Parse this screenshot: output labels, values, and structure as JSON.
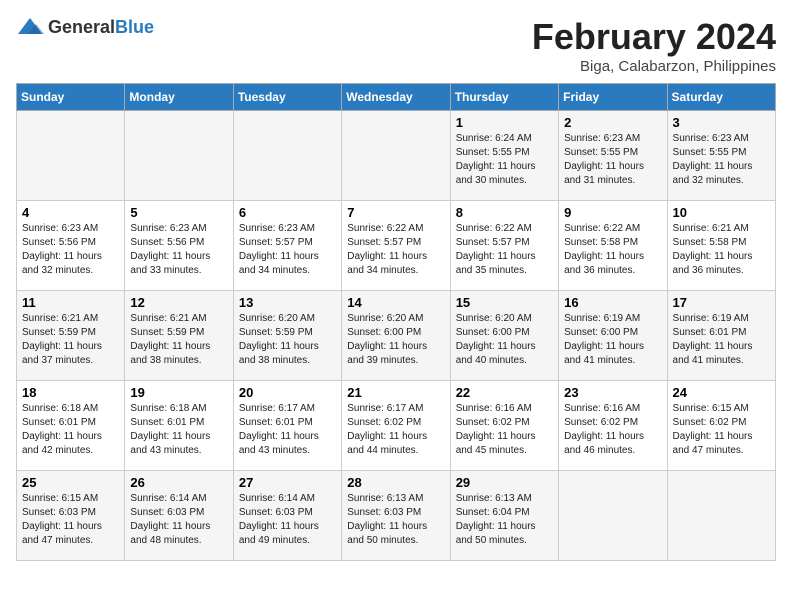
{
  "logo": {
    "general": "General",
    "blue": "Blue"
  },
  "title": "February 2024",
  "subtitle": "Biga, Calabarzon, Philippines",
  "days_header": [
    "Sunday",
    "Monday",
    "Tuesday",
    "Wednesday",
    "Thursday",
    "Friday",
    "Saturday"
  ],
  "weeks": [
    [
      {
        "day": "",
        "info": ""
      },
      {
        "day": "",
        "info": ""
      },
      {
        "day": "",
        "info": ""
      },
      {
        "day": "",
        "info": ""
      },
      {
        "day": "1",
        "info": "Sunrise: 6:24 AM\nSunset: 5:55 PM\nDaylight: 11 hours and 30 minutes."
      },
      {
        "day": "2",
        "info": "Sunrise: 6:23 AM\nSunset: 5:55 PM\nDaylight: 11 hours and 31 minutes."
      },
      {
        "day": "3",
        "info": "Sunrise: 6:23 AM\nSunset: 5:55 PM\nDaylight: 11 hours and 32 minutes."
      }
    ],
    [
      {
        "day": "4",
        "info": "Sunrise: 6:23 AM\nSunset: 5:56 PM\nDaylight: 11 hours and 32 minutes."
      },
      {
        "day": "5",
        "info": "Sunrise: 6:23 AM\nSunset: 5:56 PM\nDaylight: 11 hours and 33 minutes."
      },
      {
        "day": "6",
        "info": "Sunrise: 6:23 AM\nSunset: 5:57 PM\nDaylight: 11 hours and 34 minutes."
      },
      {
        "day": "7",
        "info": "Sunrise: 6:22 AM\nSunset: 5:57 PM\nDaylight: 11 hours and 34 minutes."
      },
      {
        "day": "8",
        "info": "Sunrise: 6:22 AM\nSunset: 5:57 PM\nDaylight: 11 hours and 35 minutes."
      },
      {
        "day": "9",
        "info": "Sunrise: 6:22 AM\nSunset: 5:58 PM\nDaylight: 11 hours and 36 minutes."
      },
      {
        "day": "10",
        "info": "Sunrise: 6:21 AM\nSunset: 5:58 PM\nDaylight: 11 hours and 36 minutes."
      }
    ],
    [
      {
        "day": "11",
        "info": "Sunrise: 6:21 AM\nSunset: 5:59 PM\nDaylight: 11 hours and 37 minutes."
      },
      {
        "day": "12",
        "info": "Sunrise: 6:21 AM\nSunset: 5:59 PM\nDaylight: 11 hours and 38 minutes."
      },
      {
        "day": "13",
        "info": "Sunrise: 6:20 AM\nSunset: 5:59 PM\nDaylight: 11 hours and 38 minutes."
      },
      {
        "day": "14",
        "info": "Sunrise: 6:20 AM\nSunset: 6:00 PM\nDaylight: 11 hours and 39 minutes."
      },
      {
        "day": "15",
        "info": "Sunrise: 6:20 AM\nSunset: 6:00 PM\nDaylight: 11 hours and 40 minutes."
      },
      {
        "day": "16",
        "info": "Sunrise: 6:19 AM\nSunset: 6:00 PM\nDaylight: 11 hours and 41 minutes."
      },
      {
        "day": "17",
        "info": "Sunrise: 6:19 AM\nSunset: 6:01 PM\nDaylight: 11 hours and 41 minutes."
      }
    ],
    [
      {
        "day": "18",
        "info": "Sunrise: 6:18 AM\nSunset: 6:01 PM\nDaylight: 11 hours and 42 minutes."
      },
      {
        "day": "19",
        "info": "Sunrise: 6:18 AM\nSunset: 6:01 PM\nDaylight: 11 hours and 43 minutes."
      },
      {
        "day": "20",
        "info": "Sunrise: 6:17 AM\nSunset: 6:01 PM\nDaylight: 11 hours and 43 minutes."
      },
      {
        "day": "21",
        "info": "Sunrise: 6:17 AM\nSunset: 6:02 PM\nDaylight: 11 hours and 44 minutes."
      },
      {
        "day": "22",
        "info": "Sunrise: 6:16 AM\nSunset: 6:02 PM\nDaylight: 11 hours and 45 minutes."
      },
      {
        "day": "23",
        "info": "Sunrise: 6:16 AM\nSunset: 6:02 PM\nDaylight: 11 hours and 46 minutes."
      },
      {
        "day": "24",
        "info": "Sunrise: 6:15 AM\nSunset: 6:02 PM\nDaylight: 11 hours and 47 minutes."
      }
    ],
    [
      {
        "day": "25",
        "info": "Sunrise: 6:15 AM\nSunset: 6:03 PM\nDaylight: 11 hours and 47 minutes."
      },
      {
        "day": "26",
        "info": "Sunrise: 6:14 AM\nSunset: 6:03 PM\nDaylight: 11 hours and 48 minutes."
      },
      {
        "day": "27",
        "info": "Sunrise: 6:14 AM\nSunset: 6:03 PM\nDaylight: 11 hours and 49 minutes."
      },
      {
        "day": "28",
        "info": "Sunrise: 6:13 AM\nSunset: 6:03 PM\nDaylight: 11 hours and 50 minutes."
      },
      {
        "day": "29",
        "info": "Sunrise: 6:13 AM\nSunset: 6:04 PM\nDaylight: 11 hours and 50 minutes."
      },
      {
        "day": "",
        "info": ""
      },
      {
        "day": "",
        "info": ""
      }
    ]
  ]
}
